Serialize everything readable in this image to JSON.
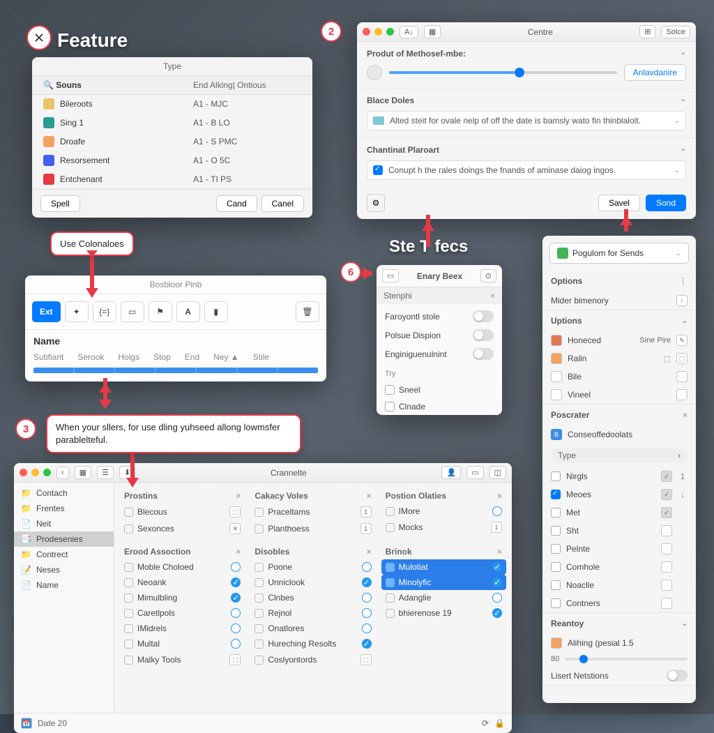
{
  "header": {
    "feature_label": "Feature",
    "step_title": "Ste T fecs"
  },
  "callouts": {
    "use": "Use Colonaloes",
    "sliders": "When your sllers, for use dling yuhseed allong lowmsfer parablelteful."
  },
  "steps": {
    "s2": "2",
    "s3": "3",
    "s6": "6"
  },
  "p1": {
    "title": "Type",
    "col1": "Souns",
    "col2": "End Alking| Ontious",
    "rows": [
      {
        "name": "Bileroots",
        "val": "A1 - MJC",
        "ic": "#e9c46a"
      },
      {
        "name": "Sing 1",
        "val": "A1 - B LO",
        "ic": "#2a9d8f"
      },
      {
        "name": "Droafe",
        "val": "A1 - S PMC",
        "ic": "#f4a261"
      },
      {
        "name": "Resorsement",
        "val": "A1 - O 5C",
        "ic": "#4361ee"
      },
      {
        "name": "Entchenant",
        "val": "A1 - TI PS",
        "ic": "#e63946"
      }
    ],
    "spell": "Spell",
    "cand": "Cand",
    "canel": "Canel"
  },
  "p2": {
    "title": "Bosbloor Pinb",
    "ext": "Ext",
    "name": "Name",
    "cols": [
      "Sutifiant",
      "Serook",
      "Holgs",
      "Stop",
      "End",
      "Ney",
      "Stile"
    ]
  },
  "centre": {
    "title": "Centre",
    "tb_left": "A↓",
    "tb_right": "Solce",
    "tb_icon": "⊞",
    "sec1_title": "Produt of Methosef-mbe:",
    "anlav": "Anlavdanire",
    "sec2_title": "Blace Doles",
    "sec2_text": "Alted steit for ovale nelp of off the date is bamsly wato fin thinblalolt.",
    "sec3_title": "Chantinat Plaroart",
    "sec3_text": "Conupt h the rales doings the fnands of aminase daiog ingos.",
    "save": "Savel",
    "send": "Sond"
  },
  "p6": {
    "title": "Enary Beex",
    "sub": "Stenphi",
    "try": "Try",
    "rows": [
      "Faroyontl stole",
      "Polsue Dispion",
      "Enginiguenulnint"
    ],
    "try_items": [
      "Sneel",
      "Clnade"
    ]
  },
  "sidebar": {
    "dropdown": "Pogulom for Sends",
    "options_hdr": "Options",
    "options_val": "Mider bimenory",
    "uptions_hdr": "Uptions",
    "uptions": [
      {
        "l": "Honeced",
        "r": "Sine Pire",
        "lic": "#e07856",
        "ric_edit": true
      },
      {
        "l": "Ralin",
        "r": "⬚",
        "lic": "#f4a261"
      },
      {
        "l": "Bile",
        "r": "",
        "lic": ""
      },
      {
        "l": "Vineel",
        "r": "",
        "lic": ""
      }
    ],
    "poscrater_hdr": "Poscrater",
    "poscrater_val": "Conseoffedoolats",
    "type_hdr": "Type",
    "type_items": [
      {
        "l": "Nirgls",
        "r": "1",
        "chk": true
      },
      {
        "l": "Meoes",
        "r": "↓",
        "chk": true,
        "on": true
      },
      {
        "l": "Met",
        "r": "",
        "chk": true
      },
      {
        "l": "Sht",
        "r": ""
      },
      {
        "l": "Pelnte",
        "r": ""
      },
      {
        "l": "Comhole",
        "r": ""
      },
      {
        "l": "Noaclle",
        "r": ""
      },
      {
        "l": "Contners",
        "r": ""
      }
    ],
    "reantoy_hdr": "Reantoy",
    "reantoy_val": "Alihing (pesial 1.5",
    "reantoy_num": "80",
    "lisert": "Lisert Netstions"
  },
  "crannite": {
    "title": "Crannelte",
    "side": [
      "Contach",
      "Frentes",
      "Neit",
      "Prodesenies",
      "Contrect",
      "Neses",
      "Name"
    ],
    "side_sel": 3,
    "date": "Date 20",
    "cols": [
      {
        "hdr": "Prostins",
        "items": [
          {
            "n": "Blecous",
            "ind": "box"
          },
          {
            "n": "Sexonces",
            "ind": "x"
          }
        ]
      },
      {
        "hdr": "Cakacy Voles",
        "items": [
          {
            "n": "Praceltams",
            "ind": "1"
          },
          {
            "n": "Planthoess",
            "ind": "1"
          }
        ]
      },
      {
        "hdr": "Postion Olaties",
        "items": [
          {
            "n": "IMore",
            "ind": "o"
          },
          {
            "n": "Mocks",
            "ind": "1"
          }
        ]
      }
    ],
    "cols2": [
      {
        "hdr": "Erood Assoction",
        "items": [
          {
            "n": "Moble Choloed",
            "ind": "o"
          },
          {
            "n": "Neoank",
            "ind": "blue"
          },
          {
            "n": "Mimulbling",
            "ind": "blue"
          },
          {
            "n": "Caretlpols",
            "ind": "o"
          },
          {
            "n": "IMidrels",
            "ind": "o"
          },
          {
            "n": "Multal",
            "ind": "o"
          },
          {
            "n": "Malky Tools",
            "ind": "box"
          }
        ]
      },
      {
        "hdr": "Disobles",
        "items": [
          {
            "n": "Poone",
            "ind": "o"
          },
          {
            "n": "Unniclook",
            "ind": "blue"
          },
          {
            "n": "Clnbes",
            "ind": "o"
          },
          {
            "n": "Rejnol",
            "ind": "o"
          },
          {
            "n": "Onatlores",
            "ind": "o"
          },
          {
            "n": "Hureching Resolts",
            "ind": "blue"
          },
          {
            "n": "Coslyontords",
            "ind": "box"
          }
        ]
      },
      {
        "hdr": "Brinok",
        "items": [
          {
            "n": "Mulotiat",
            "ind": "blue",
            "sel": true
          },
          {
            "n": "Minolyfic",
            "ind": "blue",
            "sel": true
          },
          {
            "n": "Adanglie",
            "ind": "o"
          },
          {
            "n": "bhierenose 19",
            "ind": "blue"
          }
        ]
      }
    ]
  }
}
